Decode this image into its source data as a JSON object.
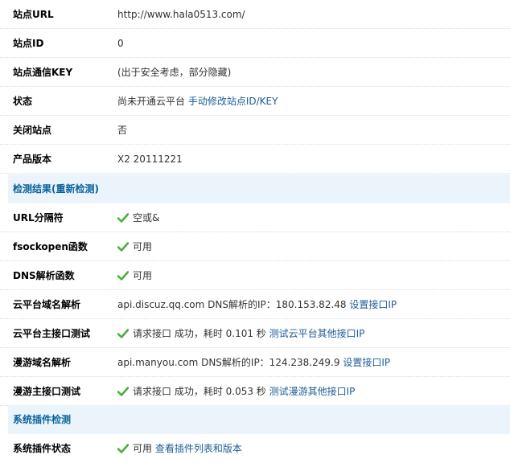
{
  "rows": {
    "site_url": {
      "label": "站点URL",
      "value": "http://www.hala0513.com/"
    },
    "site_id": {
      "label": "站点ID",
      "value": "0"
    },
    "site_key": {
      "label": "站点通信KEY",
      "value": "(出于安全考虑，部分隐藏)"
    },
    "status": {
      "label": "状态",
      "value": "尚未开通云平台",
      "link": "手动修改站点ID/KEY"
    },
    "close_site": {
      "label": "关闭站点",
      "value": "否"
    },
    "version": {
      "label": "产品版本",
      "value": "X2 20111221"
    }
  },
  "section1": {
    "title": "检测结果(重新检测)"
  },
  "checks": {
    "url_sep": {
      "label": "URL分隔符",
      "value": "空或&"
    },
    "fsockopen": {
      "label": "fsockopen函数",
      "value": "可用"
    },
    "dns": {
      "label": "DNS解析函数",
      "value": "可用"
    },
    "cloud_dns": {
      "label": "云平台域名解析",
      "value": "api.discuz.qq.com DNS解析的IP：180.153.82.48",
      "link": "设置接口IP"
    },
    "cloud_api": {
      "label": "云平台主接口测试",
      "value": "请求接口 成功，耗时 0.101 秒",
      "link": "测试云平台其他接口IP"
    },
    "manyou_dns": {
      "label": "漫游域名解析",
      "value": "api.manyou.com DNS解析的IP：124.238.249.9",
      "link": "设置接口IP"
    },
    "manyou_api": {
      "label": "漫游主接口测试",
      "value": "请求接口 成功，耗时 0.053 秒",
      "link": "测试漫游其他接口IP"
    }
  },
  "section2": {
    "title": "系统插件检测"
  },
  "plugin": {
    "label": "系统插件状态",
    "value": "可用",
    "link": "查看插件列表和版本"
  },
  "colors": {
    "check": "#4caf3a",
    "link": "#1d5b95",
    "header_bg": "#ebf3fb",
    "header_text": "#09629b"
  }
}
